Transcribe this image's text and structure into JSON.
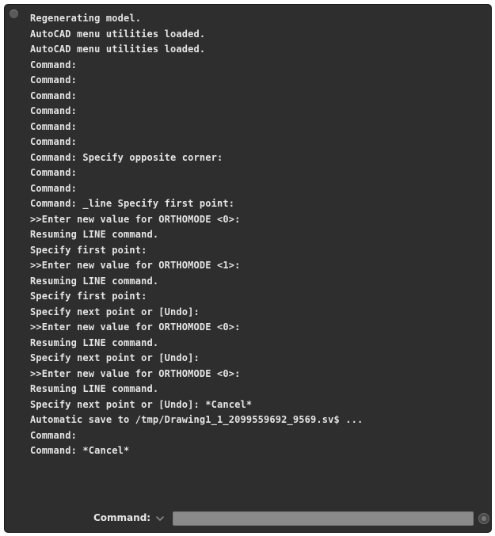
{
  "history": [
    "Regenerating model.",
    "AutoCAD menu utilities loaded.",
    "AutoCAD menu utilities loaded.",
    "Command:",
    "Command:",
    "Command:",
    "Command:",
    "Command:",
    "Command:",
    "Command: Specify opposite corner:",
    "Command:",
    "Command:",
    "Command: _line Specify first point:",
    ">>Enter new value for ORTHOMODE <0>:",
    "Resuming LINE command.",
    "Specify first point:",
    ">>Enter new value for ORTHOMODE <1>:",
    "Resuming LINE command.",
    "Specify first point:",
    "Specify next point or [Undo]:",
    ">>Enter new value for ORTHOMODE <0>:",
    "Resuming LINE command.",
    "Specify next point or [Undo]:",
    ">>Enter new value for ORTHOMODE <0>:",
    "Resuming LINE command.",
    "Specify next point or [Undo]: *Cancel*",
    "Automatic save to /tmp/Drawing1_1_2099559692_9569.sv$ ...",
    "Command:",
    "Command: *Cancel*"
  ],
  "command_bar": {
    "label": "Command:",
    "input_value": ""
  },
  "icons": {
    "history_dropdown": "chevron-down-icon",
    "clear": "clear-icon",
    "window_close": "close-icon"
  },
  "colors": {
    "background": "#2e2e2e",
    "text": "#e4e4e4",
    "input": "#8a8a8a"
  }
}
